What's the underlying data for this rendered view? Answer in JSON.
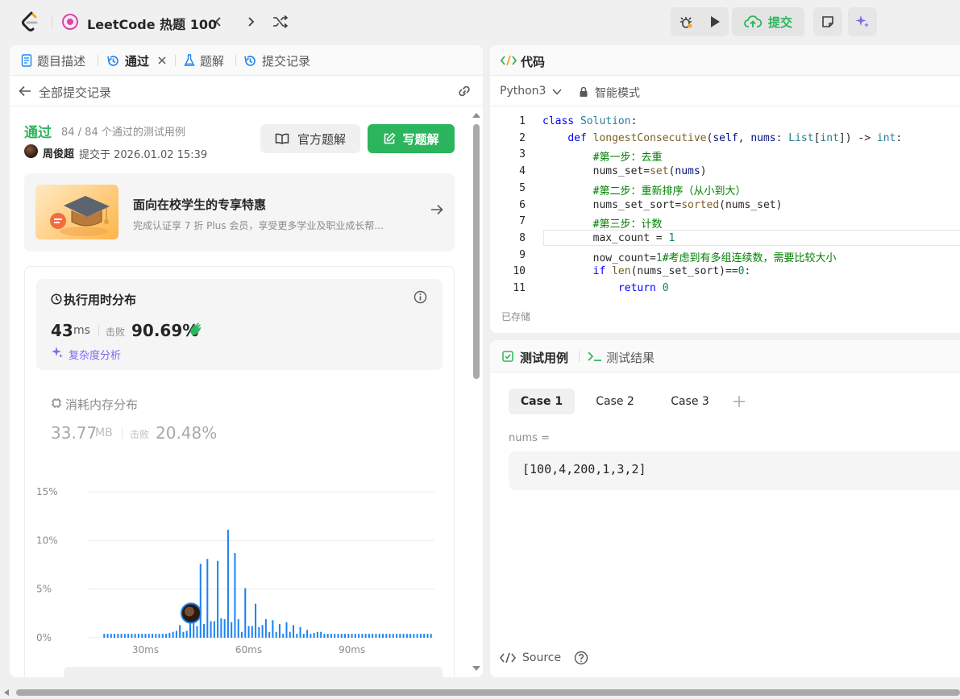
{
  "topbar": {
    "problem_list_title": "LeetCode 热题 100",
    "submit_label": "提交"
  },
  "left_tabs": [
    {
      "label": "题目描述"
    },
    {
      "label": "通过"
    },
    {
      "label": "题解"
    },
    {
      "label": "提交记录"
    }
  ],
  "back": {
    "label": "全部提交记录"
  },
  "submission": {
    "status": "通过",
    "passed": "84 / 84 个通过的测试用例",
    "author": "周俊超",
    "submitted_at": "提交于 2026.01.02 15:39",
    "official_solution_label": "官方题解",
    "write_solution_label": "写题解"
  },
  "promo": {
    "title": "面向在校学生的专享特惠",
    "subtitle": "完成认证享 7 折 Plus 会员，享受更多学业及职业成长帮..."
  },
  "runtime": {
    "title": "执行用时分布",
    "value": "43",
    "unit": "ms",
    "beat_label": "击败",
    "beat": "90.69%",
    "complexity_label": "复杂度分析"
  },
  "memory": {
    "title": "消耗内存分布",
    "value": "33.77",
    "unit": "MB",
    "beat_label": "击败",
    "beat": "20.48%"
  },
  "chart_data": {
    "type": "bar",
    "y_ticks": [
      "15%",
      "10%",
      "5%",
      "0%"
    ],
    "x_ticks": [
      {
        "label": "30ms",
        "value": 30
      },
      {
        "label": "60ms",
        "value": 60
      },
      {
        "label": "90ms",
        "value": 90
      }
    ],
    "ylim": [
      0,
      15
    ],
    "xlim": [
      17,
      114
    ],
    "bar_color": "#1a82f1",
    "highlight_x": 43,
    "x": [
      18,
      19,
      20,
      21,
      22,
      23,
      24,
      25,
      26,
      27,
      28,
      29,
      30,
      31,
      32,
      33,
      34,
      35,
      36,
      37,
      38,
      39,
      40,
      41,
      42,
      43,
      44,
      45,
      46,
      47,
      48,
      49,
      50,
      51,
      52,
      53,
      54,
      55,
      56,
      57,
      58,
      59,
      60,
      61,
      62,
      63,
      64,
      65,
      66,
      67,
      68,
      69,
      70,
      71,
      72,
      73,
      74,
      75,
      76,
      77,
      78,
      79,
      80,
      81,
      82,
      83,
      84,
      85,
      86,
      87,
      88,
      89,
      90,
      91,
      92,
      93,
      94,
      95,
      96,
      97,
      98,
      99,
      100,
      101,
      102,
      103,
      104,
      105,
      106,
      107,
      108,
      109,
      110,
      111,
      112,
      113
    ],
    "values": [
      0.4,
      0.4,
      0.4,
      0.4,
      0.4,
      0.4,
      0.4,
      0.4,
      0.4,
      0.4,
      0.4,
      0.4,
      0.4,
      0.4,
      0.4,
      0.4,
      0.4,
      0.4,
      0.4,
      0.5,
      0.6,
      0.7,
      1.3,
      0.6,
      0.7,
      3.6,
      1.5,
      1.2,
      7.6,
      1.4,
      8.1,
      1.7,
      1.7,
      7.9,
      2.0,
      1.9,
      11.1,
      1.6,
      8.7,
      1.9,
      0.6,
      5.1,
      1.2,
      1.2,
      3.5,
      1.1,
      1.3,
      1.9,
      0.6,
      1.8,
      0.6,
      1.4,
      0.4,
      1.6,
      0.6,
      1.3,
      0.4,
      1.1,
      0.4,
      0.8,
      0.4,
      0.5,
      0.6,
      0.6,
      0.4,
      0.4,
      0.4,
      0.4,
      0.4,
      0.4,
      0.4,
      0.4,
      0.4,
      0.4,
      0.4,
      0.4,
      0.4,
      0.4,
      0.4,
      0.4,
      0.4,
      0.4,
      0.4,
      0.4,
      0.4,
      0.4,
      0.4,
      0.4,
      0.4,
      0.4,
      0.4,
      0.4,
      0.4,
      0.4,
      0.4,
      0.4
    ]
  },
  "code": {
    "title": "代码",
    "language": "Python3",
    "mode": "智能模式",
    "saved": "已存储",
    "lines": [
      {
        "n": "1",
        "text": "class Solution:"
      },
      {
        "n": "2",
        "text": "    def longestConsecutive(self, nums: List[int]) -> int:"
      },
      {
        "n": "3",
        "text": "        #第一步：去重"
      },
      {
        "n": "4",
        "text": "        nums_set=set(nums)"
      },
      {
        "n": "5",
        "text": "        #第二步：重新排序（从小到大）"
      },
      {
        "n": "6",
        "text": "        nums_set_sort=sorted(nums_set)"
      },
      {
        "n": "7",
        "text": "        #第三步：计数"
      },
      {
        "n": "8",
        "text": "        max_count = 1"
      },
      {
        "n": "9",
        "text": "        now_count=1#考虑到有多组连续数，需要比较大小"
      },
      {
        "n": "10",
        "text": "        if len(nums_set_sort)==0:"
      },
      {
        "n": "11",
        "text": "            return 0"
      }
    ]
  },
  "tests": {
    "tab_cases": "测试用例",
    "tab_result": "测试结果",
    "cases": [
      "Case 1",
      "Case 2",
      "Case 3"
    ],
    "param_name": "nums =",
    "param_value": "[100,4,200,1,3,2]",
    "source_label": "Source"
  },
  "colors": {
    "accent_green": "#2db55d",
    "bar_blue": "#1a82f1",
    "ai_purple": "#7c6af0"
  }
}
